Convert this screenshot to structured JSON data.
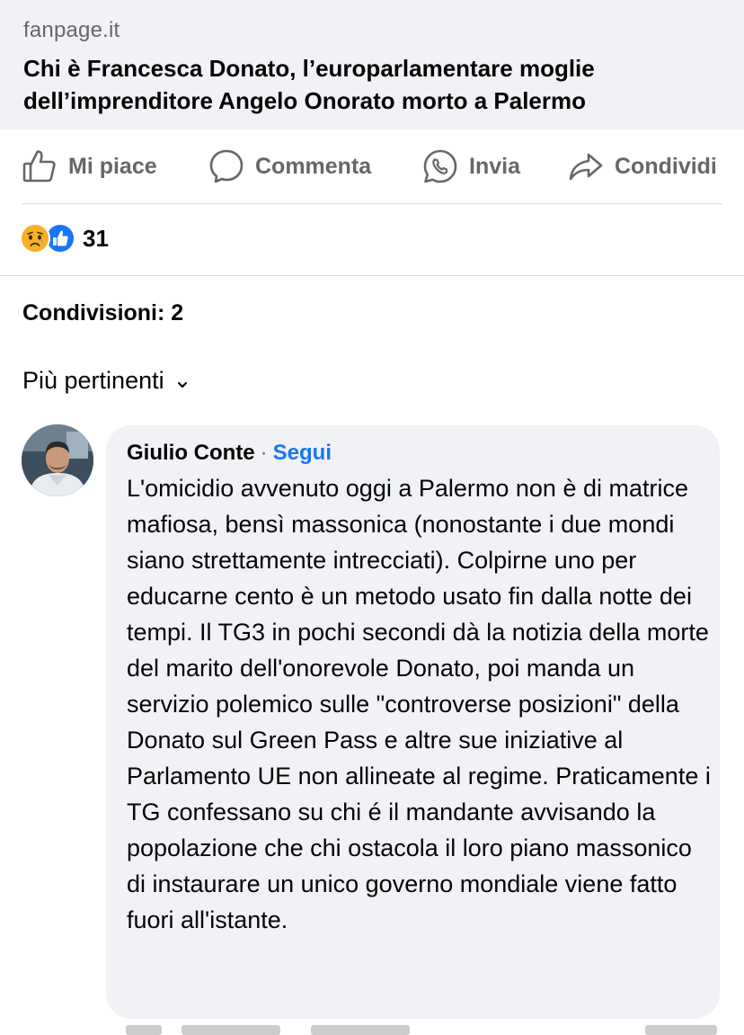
{
  "link_preview": {
    "source": "fanpage.it",
    "title": "Chi è Francesca Donato, l’europarlamentare moglie dell’imprenditore Angelo Onorato morto a Palermo"
  },
  "actions": {
    "like": {
      "label": "Mi piace",
      "icon": "thumbs-up-icon"
    },
    "comment": {
      "label": "Commenta",
      "icon": "speech-bubble-icon"
    },
    "send": {
      "label": "Invia",
      "icon": "whatsapp-icon"
    },
    "share": {
      "label": "Condividi",
      "icon": "share-arrow-icon"
    }
  },
  "reactions": {
    "types": [
      "sad",
      "like"
    ],
    "count": "31"
  },
  "shares_label": "Condivisioni: 2",
  "sort": {
    "label": "Più pertinenti",
    "icon": "chevron-down-icon"
  },
  "comment": {
    "author": "Giulio Conte",
    "separator": "·",
    "follow_label": "Segui",
    "text": "L'omicidio avvenuto oggi a Palermo non è di matrice mafiosa, bensì massonica (nonostante i due mondi siano strettamente intrecciati). Colpirne uno per educarne cento è un metodo usato fin dalla notte dei tempi. Il TG3 in pochi secondi dà la notizia della morte del marito dell'onorevole Donato, poi manda un servizio polemico sulle \"controverse posizioni\" della Donato sul Green Pass e altre sue iniziative al Parlamento UE non allineate al regime. Praticamente i TG confessano su chi é il mandante avvisando la popolazione che chi ostacola il loro piano massonico di instaurare un unico governo mondiale viene fatto fuori all'istante."
  },
  "colors": {
    "link_card_bg": "#f0f2f5",
    "secondary_text": "#65676b",
    "accent_blue": "#1877f2",
    "bubble_bg": "#f0f2f5",
    "sad_yellow": "#f7b125"
  }
}
